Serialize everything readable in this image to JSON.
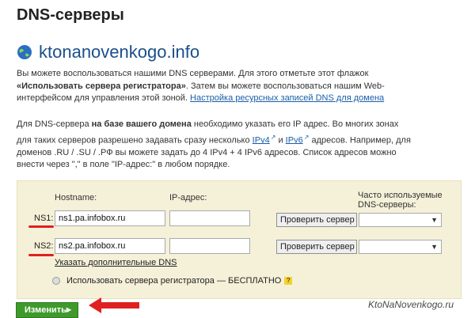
{
  "page": {
    "title": "DNS-серверы",
    "domain": "ktonanovenkogo.info",
    "para1": {
      "line1": "Вы можете воспользоваться нашими DNS серверами. Для этого отметьте этот флажок",
      "line2_bold": "«Использовать сервера регистратора»",
      "line2_rest": ". Затем вы можете воспользоваться нашим Web-",
      "line3_start": "интерфейсом для управления этой зоной.",
      "link": "Настройка ресурсных записей DNS для домена"
    },
    "para2": {
      "l1_start": "Для DNS-сервера",
      "l1_bold": "на базе вашего домена",
      "l1_end": "необходимо указать его IP адрес. Во многих зонах",
      "l2_start": "для таких серверов разрешено задавать сразу несколько",
      "ipv4": "IPv4",
      "and": "и",
      "ipv6": "IPv6",
      "l2_end": "адресов. Например, для",
      "l3": "доменов .RU / .SU / .РФ вы можете задать до 4 IPv4 + 4 IPv6 адресов. Список адресов можно",
      "l4": "внести через \",\" в поле \"IP-адрес:\" в любом порядке."
    }
  },
  "form": {
    "col_hostname": "Hostname:",
    "col_ip": "IP-адрес:",
    "col_often_1": "Часто используемые",
    "col_often_2": "DNS-серверы:",
    "ns1_label": "NS1:",
    "ns1_value": "ns1.pa.infobox.ru",
    "ns1_ip": "",
    "ns2_label": "NS2:",
    "ns2_value": "ns2.pa.infobox.ru",
    "ns2_ip": "",
    "check_button": "Проверить сервер",
    "add_dns_link": "Указать дополнительные DNS",
    "use_registrar_checkbox": "Использовать сервера регистратора — БЕСПЛАТНО",
    "help_mark": "?",
    "submit": "Изменить"
  },
  "watermark": "KtoNaNovenkogo.ru",
  "colors": {
    "link": "#1a5fa8",
    "domain": "#1a4f8b",
    "panel_bg": "#f5f1d9",
    "accent_red": "#e02020",
    "button_green": "#3f9a2c"
  }
}
